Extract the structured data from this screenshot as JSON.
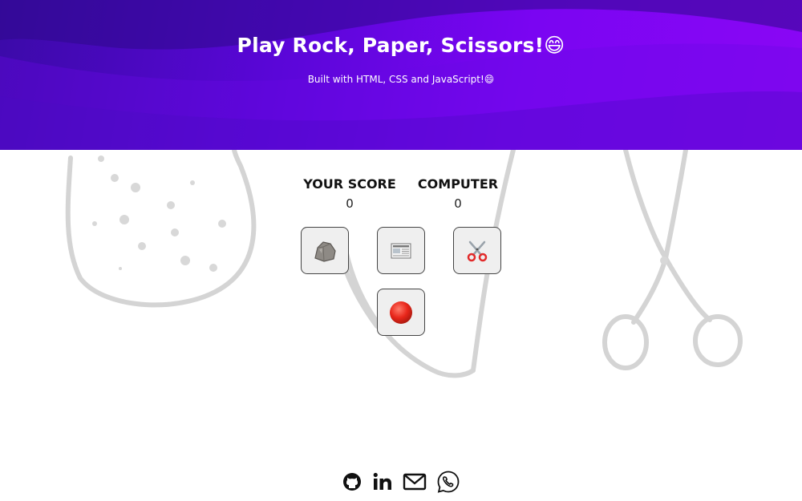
{
  "header": {
    "title": "Play Rock, Paper, Scissors!😄",
    "subtitle": "Built with HTML, CSS and JavaScript!😄"
  },
  "scores": {
    "player_label": "YOUR SCORE",
    "player_value": "0",
    "computer_label": "COMPUTER",
    "computer_value": "0"
  },
  "choices": [
    {
      "name": "rock",
      "icon": "rock-icon"
    },
    {
      "name": "paper",
      "icon": "newspaper-icon"
    },
    {
      "name": "scissors",
      "icon": "scissors-icon"
    }
  ],
  "reset": {
    "icon": "red-circle-icon"
  },
  "footer_links": [
    {
      "name": "github",
      "icon": "github-icon"
    },
    {
      "name": "linkedin",
      "icon": "linkedin-icon"
    },
    {
      "name": "email",
      "icon": "email-icon"
    },
    {
      "name": "whatsapp",
      "icon": "whatsapp-icon"
    }
  ],
  "colors": {
    "header_start": "#3b0aa8",
    "header_end": "#8a06f5",
    "reset_red": "#e8261a"
  }
}
